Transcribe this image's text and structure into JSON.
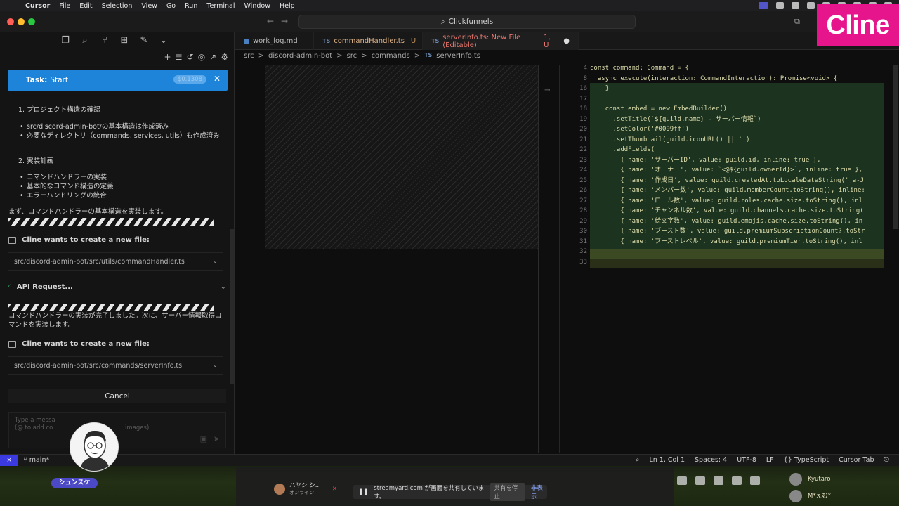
{
  "menubar": {
    "app": "Cursor",
    "items": [
      "File",
      "Edit",
      "Selection",
      "View",
      "Go",
      "Run",
      "Terminal",
      "Window",
      "Help"
    ]
  },
  "titlebar": {
    "search": "Clickfunnels"
  },
  "badge": {
    "text": "Cline"
  },
  "sidebar": {
    "task_label": "Task:",
    "task_title": "Start",
    "task_cost": "$0.1308",
    "section1_title": "1. プロジェクト構造の確認",
    "section1_items": [
      "src/discord-admin-bot/の基本構造は作成済み",
      "必要なディレクトリ（commands, services, utils）も作成済み"
    ],
    "section2_title": "2. 実装計画",
    "section2_items": [
      "コマンドハンドラーの実装",
      "基本的なコマンド構造の定義",
      "エラーハンドリングの統合"
    ],
    "message1": "まず、コマンドハンドラーの基本構造を実装します。",
    "create_file_label": "Cline wants to create a new file:",
    "file1": "src/discord-admin-bot/src/utils/commandHandler.ts",
    "api_request": "API Request...",
    "message2": "コマンドハンドラーの実装が完了しました。次に、サーバー情報取得コマンドを実装します。",
    "file2": "src/discord-admin-bot/src/commands/serverInfo.ts",
    "cancel": "Cancel",
    "input_placeholder_1": "Type a messa",
    "input_placeholder_2": "(@ to add co",
    "input_placeholder_3": "images)",
    "avatar_name": "シュンスケ"
  },
  "tabs": [
    {
      "label": "work_log.md",
      "kind": "md",
      "suffix": ""
    },
    {
      "label": "commandHandler.ts",
      "kind": "ts",
      "suffix": "U"
    },
    {
      "label": "serverInfo.ts: New File (Editable)",
      "kind": "ts",
      "suffix": "1, U"
    }
  ],
  "breadcrumb": [
    "src",
    ">",
    "discord-admin-bot",
    ">",
    "src",
    ">",
    "commands",
    ">",
    "TS",
    "serverInfo.ts"
  ],
  "code": {
    "lines": [
      {
        "n": "4",
        "t": "const command: Command = {"
      },
      {
        "n": "8",
        "t": "  async execute(interaction: CommandInteraction): Promise<void> {"
      },
      {
        "n": "16",
        "t": "    }"
      },
      {
        "n": "17",
        "t": ""
      },
      {
        "n": "18",
        "t": "    const embed = new EmbedBuilder()"
      },
      {
        "n": "19",
        "t": "      .setTitle(`${guild.name} - サーバー情報`)"
      },
      {
        "n": "20",
        "t": "      .setColor('#0099ff')"
      },
      {
        "n": "21",
        "t": "      .setThumbnail(guild.iconURL() || '')"
      },
      {
        "n": "22",
        "t": "      .addFields("
      },
      {
        "n": "23",
        "t": "        { name: 'サーバーID', value: guild.id, inline: true },"
      },
      {
        "n": "24",
        "t": "        { name: 'オーナー', value: `<@${guild.ownerId}>`, inline: true },"
      },
      {
        "n": "25",
        "t": "        { name: '作成日', value: guild.createdAt.toLocaleDateString('ja-J"
      },
      {
        "n": "26",
        "t": "        { name: 'メンバー数', value: guild.memberCount.toString(), inline:"
      },
      {
        "n": "27",
        "t": "        { name: 'ロール数', value: guild.roles.cache.size.toString(), inl"
      },
      {
        "n": "28",
        "t": "        { name: 'チャンネル数', value: guild.channels.cache.size.toString("
      },
      {
        "n": "29",
        "t": "        { name: '絵文字数', value: guild.emojis.cache.size.toString(), in"
      },
      {
        "n": "30",
        "t": "        { name: 'ブースト数', value: guild.premiumSubscriptionCount?.toStr"
      },
      {
        "n": "31",
        "t": "        { name: 'ブーストレベル', value: guild.premiumTier.toString(), inl"
      },
      {
        "n": "32",
        "t": ""
      },
      {
        "n": "33",
        "t": ""
      }
    ]
  },
  "statusbar": {
    "branch": "main*",
    "position": "Ln 1, Col 1",
    "spaces": "Spaces: 4",
    "encoding": "UTF-8",
    "eol": "LF",
    "language": "{} TypeScript",
    "cursor_tab": "Cursor Tab"
  },
  "bottom": {
    "presenter": "ハヤシ シ...",
    "presenter_status": "オンライン",
    "share_text": "streamyard.com が画面を共有しています。",
    "stop_share": "共有を停止",
    "hide": "非表示",
    "user1": "Kyutaro",
    "user2": "M*えむ*"
  }
}
